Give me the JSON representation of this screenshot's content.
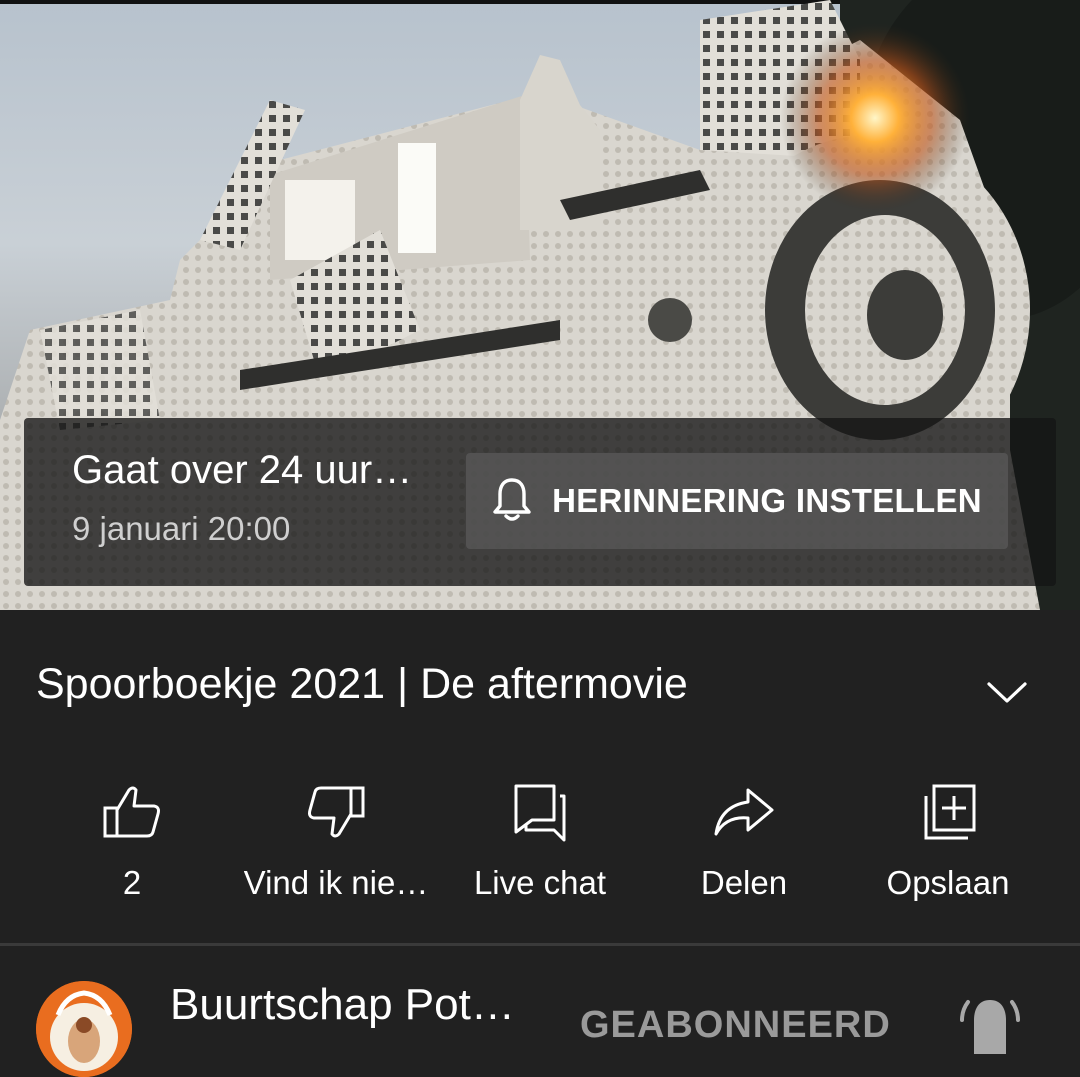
{
  "upcoming": {
    "status_text": "Gaat over 24 uur…",
    "scheduled_date": "9 januari 20:00",
    "reminder_button_label": "HERINNERING INSTELLEN",
    "reminder_icon": "bell-icon"
  },
  "video": {
    "title": "Spoorboekje 2021 | De aftermovie",
    "expand_icon": "chevron-down-icon"
  },
  "actions": [
    {
      "id": "like",
      "icon": "thumbs-up-icon",
      "label": "2"
    },
    {
      "id": "dislike",
      "icon": "thumbs-down-icon",
      "label": "Vind ik nie…"
    },
    {
      "id": "live-chat",
      "icon": "chat-icon",
      "label": "Live chat"
    },
    {
      "id": "share",
      "icon": "share-icon",
      "label": "Delen"
    },
    {
      "id": "save",
      "icon": "add-to-playlist-icon",
      "label": "Opslaan"
    }
  ],
  "channel": {
    "name": "Buurtschap Pot…",
    "subscribe_label": "GEABONNEERD",
    "bell_icon": "notification-bell-icon"
  },
  "colors": {
    "background": "#212121",
    "text": "#ffffff",
    "secondary_text": "#cfcfcf",
    "subscribed_text": "#9a9a9a",
    "avatar": "#e96d1f"
  }
}
